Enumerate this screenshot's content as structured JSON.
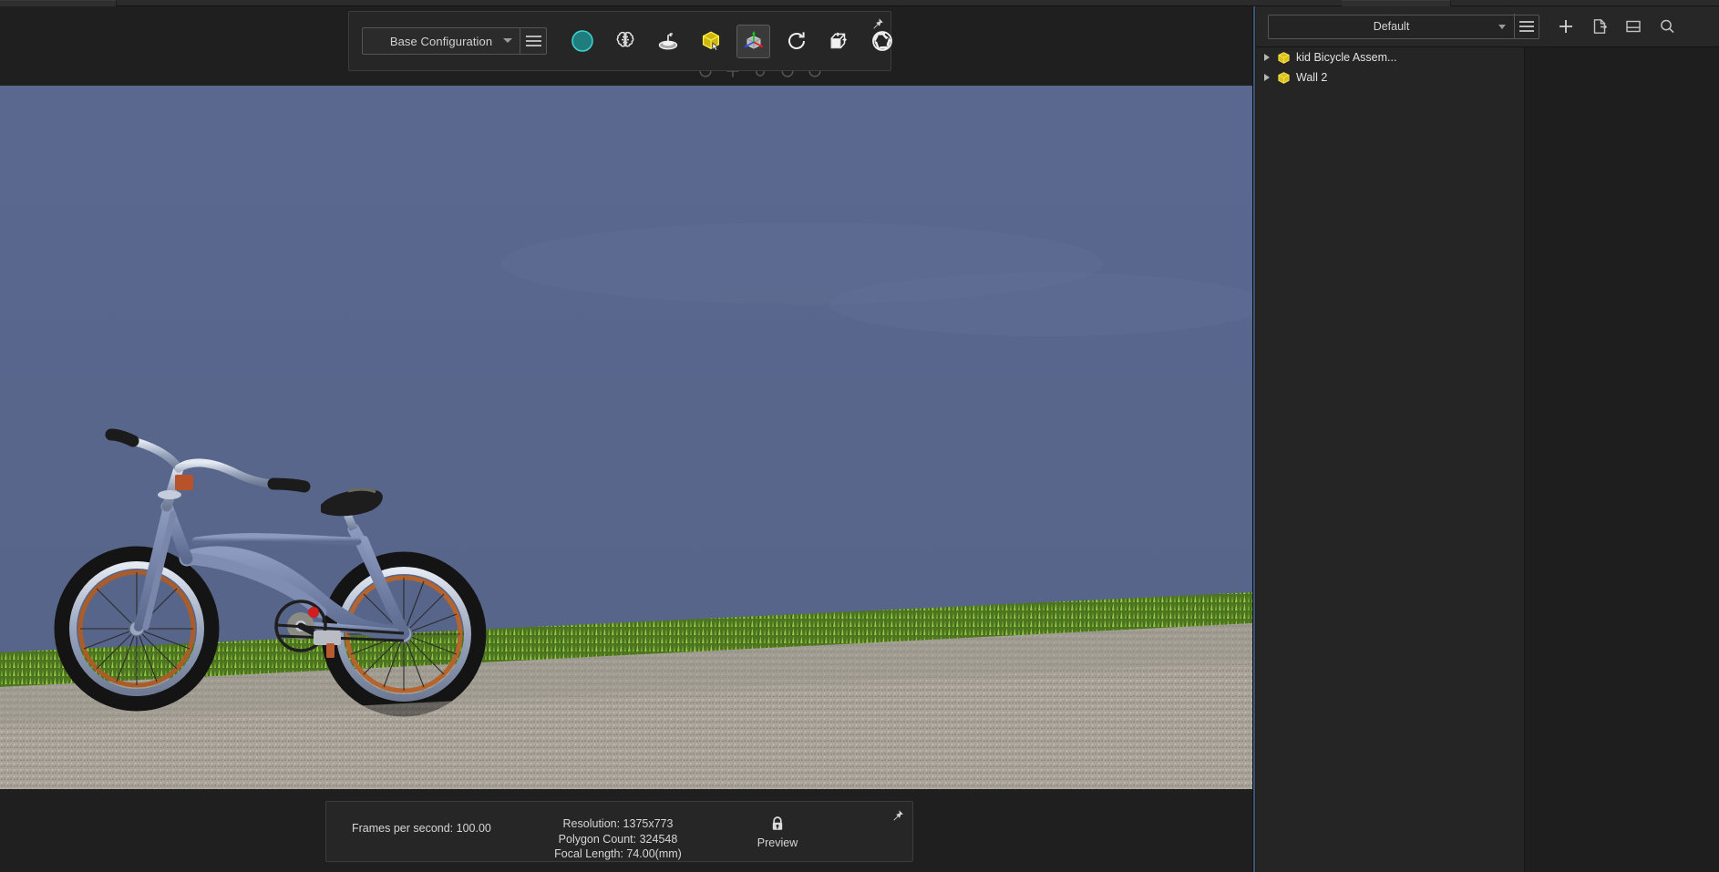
{
  "app": {
    "background_color": "#1e1e1e",
    "panel_color": "#262626",
    "accent_color": "#3b5578"
  },
  "tabstrip": {
    "tab_left_name": "viewport-tab",
    "tab_right_name": "panel-tab"
  },
  "toolbar": {
    "configuration_select": {
      "value": "Base Configuration",
      "menu_icon": "hamburger-icon"
    },
    "buttons": [
      {
        "name": "environment-sphere-icon",
        "label": "Environment",
        "state": "normal",
        "color": "#1f7d7d"
      },
      {
        "name": "brain-icon",
        "label": "Brain / AI Denoise",
        "state": "normal"
      },
      {
        "name": "turntable-icon",
        "label": "Turntable",
        "state": "normal"
      },
      {
        "name": "yellow-cube-select-icon",
        "label": "Select Object",
        "state": "normal",
        "color": "#d8c014"
      },
      {
        "name": "axis-gizmo-icon",
        "label": "Move / Transform Gizmo",
        "state": "active"
      },
      {
        "name": "refresh-icon",
        "label": "Reset / Refresh",
        "state": "normal"
      },
      {
        "name": "cube-export-icon",
        "label": "Export Geometry",
        "state": "normal"
      },
      {
        "name": "camera-aperture-icon",
        "label": "Camera",
        "state": "normal"
      }
    ],
    "pin": {
      "name": "pin-icon",
      "label": "Pin toolbar"
    }
  },
  "ghost_toolbar": {
    "icons": [
      "refresh-icon",
      "plus-icon",
      "magnet-icon",
      "refresh-icon",
      "circle-icon"
    ]
  },
  "viewport": {
    "scene_name": "kid Bicycle Assembly scene",
    "sky_color": "#57658c",
    "wall_color": "#5a678c",
    "ground_color": "#a9a49a",
    "grass_color": "#6d9a35",
    "bike_frame_color": "#6f7fa3"
  },
  "status_bar": {
    "frames_per_second": "Frames per second: 100.00",
    "resolution": "Resolution: 1375x773",
    "polygon_count": "Polygon Count: 324548",
    "focal_length": "Focal Length: 74.00(mm)",
    "preview_label": "Preview",
    "preview_icon": "lock-icon",
    "pin": {
      "name": "pin-icon",
      "label": "Pin status bar"
    }
  },
  "right_panel": {
    "scene_select": {
      "value": "Default",
      "menu_icon": "hamburger-icon"
    },
    "header_icons": [
      {
        "name": "plus-icon",
        "label": "Add"
      },
      {
        "name": "export-file-icon",
        "label": "Export"
      },
      {
        "name": "split-panel-icon",
        "label": "Split View"
      },
      {
        "name": "search-icon",
        "label": "Search"
      }
    ],
    "tree_items": [
      {
        "label": "kid Bicycle Assem...",
        "icon": "yellow-cube-icon",
        "expanded": false
      },
      {
        "label": "Wall 2",
        "icon": "yellow-cube-icon",
        "expanded": false
      }
    ]
  }
}
